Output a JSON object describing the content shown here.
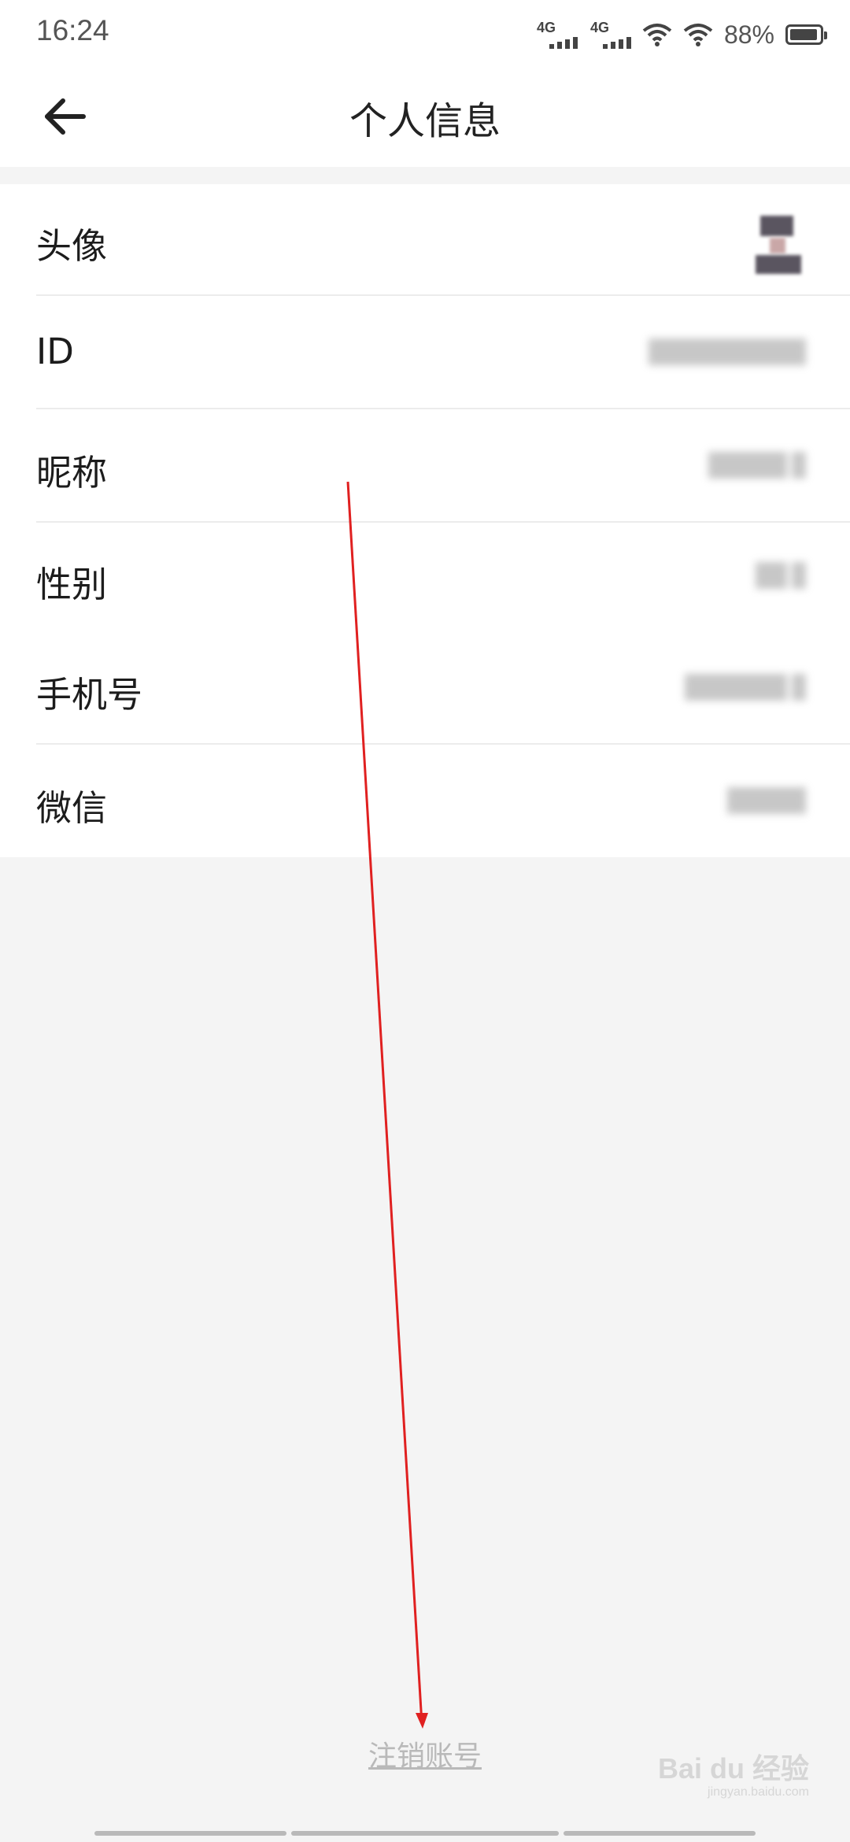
{
  "status_bar": {
    "time": "16:24",
    "signal1_label": "4G",
    "signal2_label": "4G",
    "battery_percent": "88%",
    "battery_level": 0.88
  },
  "header": {
    "title": "个人信息",
    "back_icon": "arrow-left-icon"
  },
  "profile": {
    "rows": [
      {
        "label": "头像"
      },
      {
        "label": "ID"
      },
      {
        "label": "昵称"
      },
      {
        "label": "性别"
      },
      {
        "label": "手机号"
      },
      {
        "label": "微信"
      }
    ]
  },
  "footer": {
    "logout_label": "注销账号"
  },
  "annotation": {
    "arrow_color": "#e02020"
  },
  "watermark": {
    "text": "Bai du 经验",
    "sub": "jingyan.baidu.com"
  },
  "colors": {
    "background": "#f4f4f4",
    "card": "#ffffff",
    "link_gray": "#b9b9b9"
  }
}
